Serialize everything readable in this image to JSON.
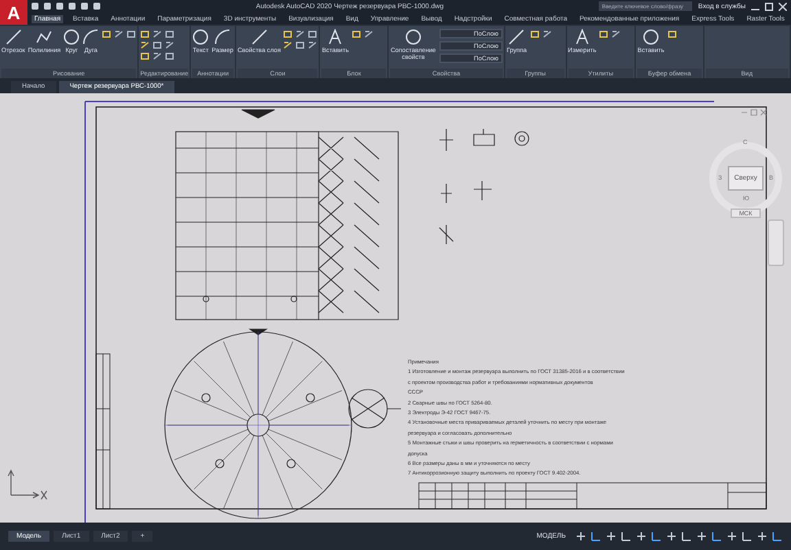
{
  "app": {
    "logo": "A",
    "title": "Autodesk AutoCAD 2020   Чертеж резервуара РВС-1000.dwg",
    "search": {
      "placeholder": "Введите ключевое слово/фразу"
    },
    "user": "Вход в службы"
  },
  "ribbon_tabs": [
    {
      "label": "Главная",
      "selected": true
    },
    {
      "label": "Вставка",
      "selected": false
    },
    {
      "label": "Аннотации",
      "selected": false
    },
    {
      "label": "Параметризация",
      "selected": false
    },
    {
      "label": "3D инструменты",
      "selected": false
    },
    {
      "label": "Визуализация",
      "selected": false
    },
    {
      "label": "Вид",
      "selected": false
    },
    {
      "label": "Управление",
      "selected": false
    },
    {
      "label": "Вывод",
      "selected": false
    },
    {
      "label": "Надстройки",
      "selected": false
    },
    {
      "label": "Совместная работа",
      "selected": false
    },
    {
      "label": "Рекомендованные приложения",
      "selected": false
    },
    {
      "label": "Express Tools",
      "selected": false
    },
    {
      "label": "Raster Tools",
      "selected": false
    }
  ],
  "panels": [
    {
      "label": "Рисование",
      "tools": [
        "Отрезок",
        "Полилиния",
        "Круг",
        "Дуга"
      ]
    },
    {
      "label": "Редактирование"
    },
    {
      "label": "Аннотации",
      "tools": [
        "Текст",
        "Размер"
      ]
    },
    {
      "label": "Слои",
      "tools": [
        "Свойства слоя"
      ]
    },
    {
      "label": "Блок",
      "tools": [
        "Вставить"
      ]
    },
    {
      "label": "Свойства",
      "tools": [
        "Сопоставление свойств"
      ],
      "dropdowns": [
        "ПоСлою",
        "ПоСлою",
        "ПоСлою"
      ]
    },
    {
      "label": "Группы",
      "tools": [
        "Группа"
      ]
    },
    {
      "label": "Утилиты",
      "tools": [
        "Измерить"
      ]
    },
    {
      "label": "Буфер обмена",
      "tools": [
        "Вставить"
      ]
    },
    {
      "label": "Вид"
    }
  ],
  "file_tabs": [
    {
      "label": "Начало",
      "selected": false
    },
    {
      "label": "Чертеж резервуара РВС-1000*",
      "selected": true
    }
  ],
  "notes": [
    "Примечания",
    "1   Изготовление и монтаж резервуара выполнить по ГОСТ 31385-2016 и в соответствии",
    "с проектом производства работ и требованиями нормативных документов",
    "СССР",
    "2   Сварные швы по ГОСТ 5264-80.",
    "3   Электроды Э-42 ГОСТ 9467-75.",
    "4   Установочные места привариваемых деталей уточнить по месту при монтаже",
    "резервуара и согласовать дополнительно",
    "5   Монтажные стыки и швы проверить на герметичность в соответствии с нормами",
    "допуска",
    "6   Все размеры даны в мм и уточняются по месту",
    "7   Антикоррозионную защиту выполнить по проекту ГОСТ 9.402-2004."
  ],
  "viewcube": {
    "face": "Сверху",
    "north": "С",
    "south": "Ю",
    "west": "З",
    "east": "В",
    "ucs": "МСК"
  },
  "layout_tabs": [
    {
      "label": "Модель",
      "selected": true
    },
    {
      "label": "Лист1",
      "selected": false
    },
    {
      "label": "Лист2",
      "selected": false
    },
    {
      "label": "+",
      "selected": false
    }
  ],
  "status": {
    "mode": "МОДЕЛЬ"
  }
}
